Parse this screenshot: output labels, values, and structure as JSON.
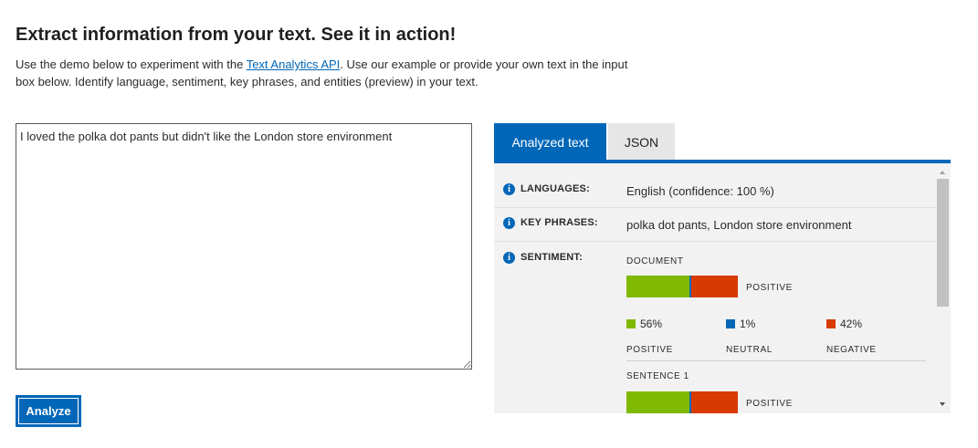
{
  "header": {
    "title": "Extract information from your text. See it in action!",
    "intro_before": "Use the demo below to experiment with the ",
    "intro_link": "Text Analytics API",
    "intro_after": ". Use our example or provide your own text in the input box below. Identify language, sentiment, key phrases, and entities (preview) in your text."
  },
  "input": {
    "value": "I loved the polka dot pants but didn't like the London store environment"
  },
  "analyze_label": "Analyze",
  "tabs": [
    {
      "label": "Analyzed text",
      "active": true
    },
    {
      "label": "JSON",
      "active": false
    }
  ],
  "results": {
    "languages_label": "LANGUAGES:",
    "languages_value": "English (confidence: 100 %)",
    "key_phrases_label": "KEY PHRASES:",
    "key_phrases_value": "polka dot pants, London store environment",
    "sentiment_label": "SENTIMENT:",
    "document_label": "DOCUMENT",
    "document_sentiment": "POSITIVE",
    "scores": {
      "positive": 0.56,
      "neutral": 0.01,
      "negative": 0.42
    },
    "legend": [
      {
        "pct": "56%",
        "label": "POSITIVE",
        "color": "#7fba00"
      },
      {
        "pct": "1%",
        "label": "NEUTRAL",
        "color": "#0067b8"
      },
      {
        "pct": "42%",
        "label": "NEGATIVE",
        "color": "#d83b01"
      }
    ],
    "sentence_label": "SENTENCE 1",
    "sentence_sentiment": "POSITIVE",
    "sentence_scores": {
      "positive": 0.56,
      "neutral": 0.01,
      "negative": 0.42
    }
  },
  "colors": {
    "accent": "#0067b8",
    "positive": "#7fba00",
    "neutral": "#0067b8",
    "negative": "#d83b01"
  }
}
